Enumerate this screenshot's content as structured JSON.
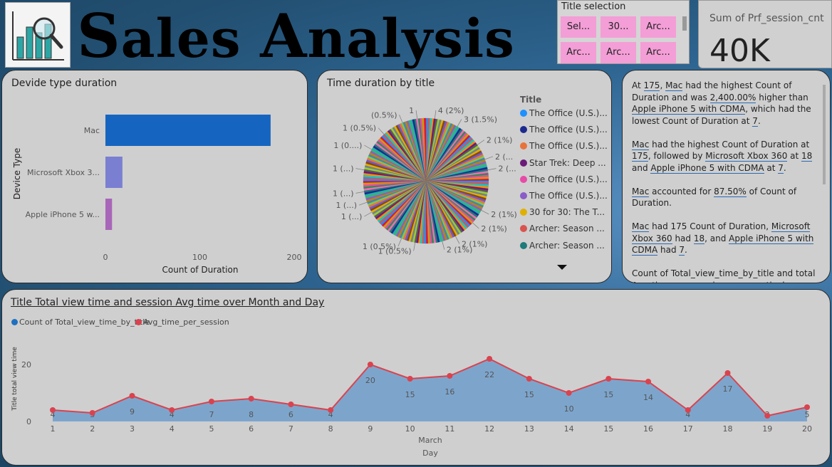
{
  "header": {
    "title": "Sales Analysis"
  },
  "slicer": {
    "title": "Title selection",
    "tiles": [
      "Sel...",
      "30...",
      "Arc...",
      "Arc...",
      "Arc...",
      "Arc..."
    ]
  },
  "kpi": {
    "label": "Sum of Prf_session_cnt",
    "value": "40K"
  },
  "device_card": {
    "title": "Devide type duration"
  },
  "pie_card": {
    "title": "Time duration by title",
    "legend_title": "Title"
  },
  "narrative": {
    "paragraphs": [
      [
        [
          "At ",
          false
        ],
        [
          "175",
          true
        ],
        [
          ", ",
          false
        ],
        [
          "Mac",
          true
        ],
        [
          " had the highest Count of Duration and was ",
          false
        ],
        [
          "2,400.00%",
          true
        ],
        [
          " higher than ",
          false
        ],
        [
          "Apple iPhone 5 with CDMA",
          true
        ],
        [
          ", which had the lowest Count of Duration at ",
          false
        ],
        [
          "7",
          true
        ],
        [
          ".",
          false
        ]
      ],
      [
        [
          "Mac",
          true
        ],
        [
          " had the highest Count of Duration at ",
          false
        ],
        [
          "175",
          true
        ],
        [
          ", followed by ",
          false
        ],
        [
          "Microsoft Xbox 360",
          true
        ],
        [
          " at ",
          false
        ],
        [
          "18",
          true
        ],
        [
          " and ",
          false
        ],
        [
          "Apple iPhone 5 with CDMA",
          true
        ],
        [
          " at ",
          false
        ],
        [
          "7",
          true
        ],
        [
          ".",
          false
        ]
      ],
      [
        [
          "Mac",
          true
        ],
        [
          " accounted for ",
          false
        ],
        [
          "87.50%",
          true
        ],
        [
          " of Count of Duration.",
          false
        ]
      ],
      [
        [
          "Mac",
          true
        ],
        [
          " had 175 Count of Duration, ",
          false
        ],
        [
          "Microsoft Xbox 360",
          true
        ],
        [
          " had ",
          false
        ],
        [
          "18",
          true
        ],
        [
          ", and ",
          false
        ],
        [
          "Apple iPhone 5 with CDMA",
          true
        ],
        [
          " had ",
          false
        ],
        [
          "7",
          true
        ],
        [
          ".",
          false
        ]
      ],
      [
        [
          "Count of Total_view_time_by_title and total Avg_time_per_session are negatively correlated",
          false
        ]
      ]
    ]
  },
  "line_card": {
    "title": "Title Total view time and session Avg time over Month and Day"
  },
  "chart_data": [
    {
      "type": "bar",
      "orientation": "horizontal",
      "title": "Devide type duration",
      "categories": [
        "Mac",
        "Microsoft Xbox 3...",
        "Apple iPhone 5 w..."
      ],
      "values": [
        175,
        18,
        7
      ],
      "colors": [
        "#1565c0",
        "#7a7fd2",
        "#a866b8"
      ],
      "xlabel": "Count of Duration",
      "ylabel": "Device Type",
      "xlim": [
        0,
        200
      ],
      "xticks": [
        "0",
        "100",
        "200"
      ]
    },
    {
      "type": "pie",
      "title": "Time duration by title",
      "slice_labels": [
        "4 (2%)",
        "3 (1.5%)",
        "2 (1%)",
        "2 (...",
        "2 (...",
        "2 (1%)",
        "2 (1%)",
        "2 (1%)",
        "2 (1%)",
        "1 (0.5%)",
        "1 (0.5%)",
        "1 (...)",
        "1 (...)",
        "1 (...)",
        "1 (...)",
        "1 (0....)",
        "1 (0.5%)",
        "(0.5%)",
        "1"
      ],
      "legend": [
        {
          "label": "The Office (U.S.)...",
          "color": "#1e90ff"
        },
        {
          "label": "The Office (U.S.)...",
          "color": "#1c2a8f"
        },
        {
          "label": "The Office (U.S.)...",
          "color": "#e8733a"
        },
        {
          "label": "Star Trek: Deep ...",
          "color": "#6b1a7a"
        },
        {
          "label": "The Office (U.S.)...",
          "color": "#e84aa8"
        },
        {
          "label": "The Office (U.S.)...",
          "color": "#8a5cc7"
        },
        {
          "label": "30 for 30: The T...",
          "color": "#e0b000"
        },
        {
          "label": "Archer: Season ...",
          "color": "#d9534f"
        },
        {
          "label": "Archer: Season ...",
          "color": "#1f7a7a"
        }
      ]
    },
    {
      "type": "area",
      "title": "Title Total view time and session Avg time over Month and Day",
      "x": [
        1,
        2,
        3,
        4,
        5,
        6,
        7,
        8,
        9,
        10,
        11,
        12,
        13,
        14,
        15,
        16,
        17,
        18,
        19,
        20
      ],
      "xlabel_month": "March",
      "xlabel": "Day",
      "ylabel": "Title total view time",
      "ylim": [
        0,
        25
      ],
      "yticks": [
        "0",
        "20"
      ],
      "series": [
        {
          "name": "Count of Total_view_time_by_title",
          "color": "#1e6fc0",
          "values": [
            4,
            3,
            9,
            4,
            7,
            8,
            6,
            4,
            20,
            15,
            16,
            22,
            15,
            10,
            15,
            14,
            4,
            17,
            2,
            5
          ]
        },
        {
          "name": "Avg_time_per_session",
          "color": "#d9434f",
          "values": [
            4,
            3,
            9,
            4,
            7,
            8,
            6,
            4,
            20,
            15,
            16,
            22,
            15,
            10,
            15,
            14,
            4,
            17,
            2,
            5
          ]
        }
      ]
    }
  ]
}
